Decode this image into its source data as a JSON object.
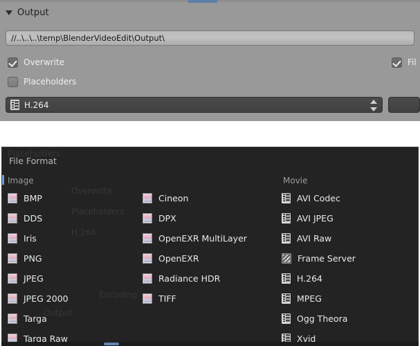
{
  "output_panel": {
    "header_label": "Output",
    "collapse_icon": "triangle-down-icon",
    "path_field": {
      "value": "//..\\..\\..\\temp\\BlenderVideoEdit\\Output\\",
      "placeholder": "//"
    },
    "checkboxes": [
      {
        "id": "overwrite",
        "label": "Overwrite",
        "checked": true
      },
      {
        "id": "placeholders",
        "label": "Placeholders",
        "checked": false
      },
      {
        "id": "file_extensions",
        "label": "Fil",
        "checked": true
      }
    ],
    "format_select": {
      "value": "H.264",
      "icon": "film-strip-icon",
      "spinner_icon": "spinner-up-down-icon"
    },
    "side_button": {
      "label": ""
    }
  },
  "file_format_menu": {
    "title": "File Format",
    "columns": [
      {
        "heading": "Image",
        "items": [
          {
            "label": "BMP",
            "icon": "image-file-icon"
          },
          {
            "label": "DDS",
            "icon": "image-file-icon"
          },
          {
            "label": "Iris",
            "icon": "image-file-icon"
          },
          {
            "label": "PNG",
            "icon": "image-file-icon"
          },
          {
            "label": "JPEG",
            "icon": "image-file-icon"
          },
          {
            "label": "JPEG 2000",
            "icon": "image-file-icon"
          },
          {
            "label": "Targa",
            "icon": "image-file-icon"
          },
          {
            "label": "Targa Raw",
            "icon": "image-file-icon"
          }
        ]
      },
      {
        "heading": "",
        "items": [
          {
            "label": "Cineon",
            "icon": "image-file-icon"
          },
          {
            "label": "DPX",
            "icon": "image-file-icon"
          },
          {
            "label": "OpenEXR MultiLayer",
            "icon": "image-file-icon"
          },
          {
            "label": "OpenEXR",
            "icon": "image-file-icon"
          },
          {
            "label": "Radiance HDR",
            "icon": "image-file-icon"
          },
          {
            "label": "TIFF",
            "icon": "image-file-icon"
          }
        ]
      },
      {
        "heading": "Movie",
        "items": [
          {
            "label": "AVI Codec",
            "icon": "film-strip-icon"
          },
          {
            "label": "AVI JPEG",
            "icon": "film-strip-icon"
          },
          {
            "label": "AVI Raw",
            "icon": "film-strip-icon"
          },
          {
            "label": "Frame Server",
            "icon": "frame-server-icon"
          },
          {
            "label": "H.264",
            "icon": "film-strip-icon"
          },
          {
            "label": "MPEG",
            "icon": "film-strip-icon"
          },
          {
            "label": "Ogg Theora",
            "icon": "film-strip-icon"
          },
          {
            "label": "Xvid",
            "icon": "film-strip-icon"
          }
        ]
      }
    ]
  },
  "colors": {
    "panel_bg": "#999999",
    "menu_bg": "#232323",
    "accent": "#5f87b4",
    "text_light": "#e9e9e9",
    "text_dark": "#1e1e1e"
  }
}
